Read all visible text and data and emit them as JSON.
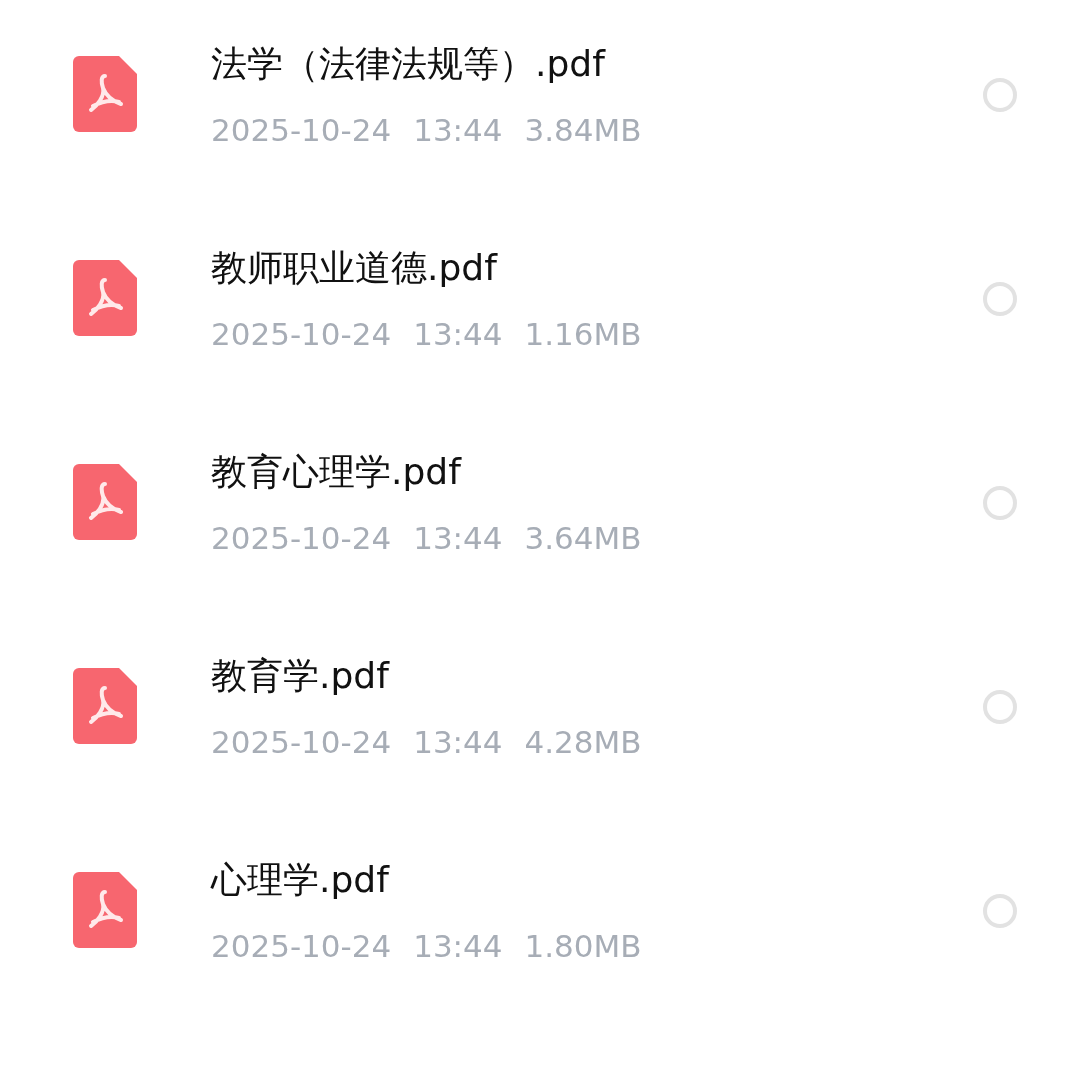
{
  "files": [
    {
      "name": "法学（法律法规等）.pdf",
      "date": "2025-10-24",
      "time": "13:44",
      "size": "3.84MB",
      "selected": false
    },
    {
      "name": "教师职业道德.pdf",
      "date": "2025-10-24",
      "time": "13:44",
      "size": "1.16MB",
      "selected": false
    },
    {
      "name": "教育心理学.pdf",
      "date": "2025-10-24",
      "time": "13:44",
      "size": "3.64MB",
      "selected": false
    },
    {
      "name": "教育学.pdf",
      "date": "2025-10-24",
      "time": "13:44",
      "size": "4.28MB",
      "selected": false
    },
    {
      "name": "心理学.pdf",
      "date": "2025-10-24",
      "time": "13:44",
      "size": "1.80MB",
      "selected": false
    }
  ]
}
